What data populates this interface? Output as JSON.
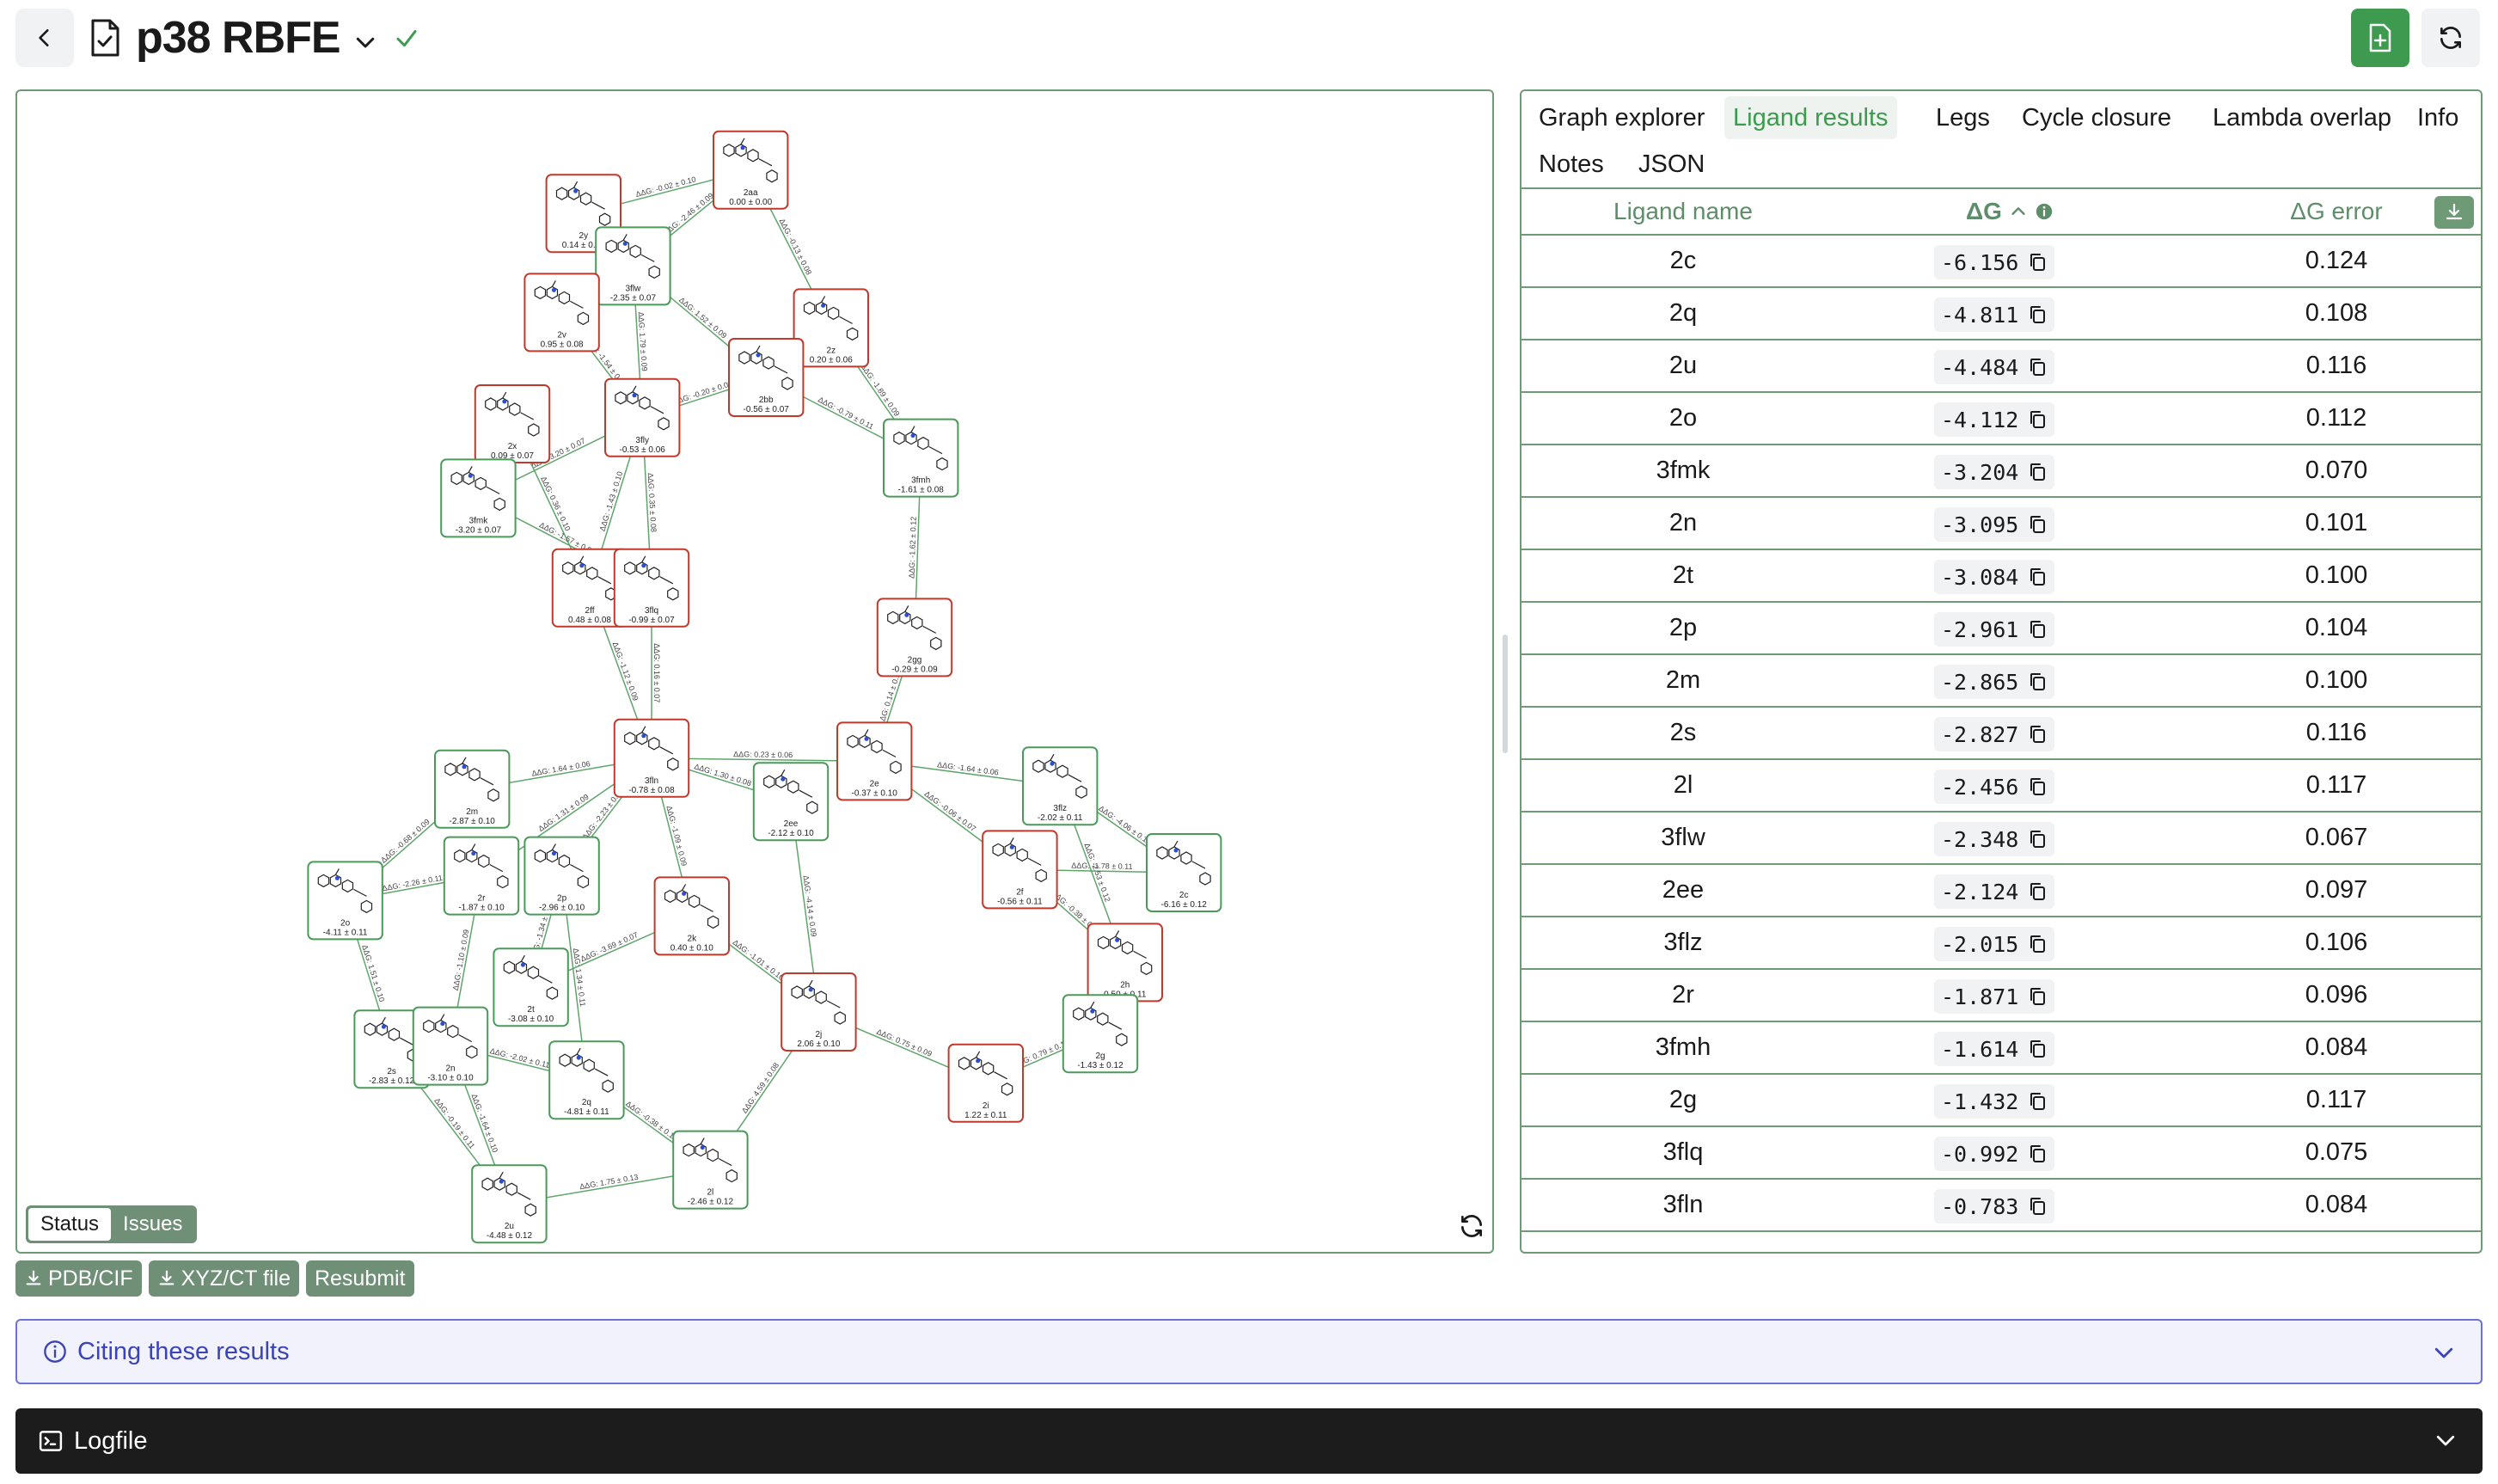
{
  "header": {
    "title": "p38 RBFE",
    "icons": {
      "back": "chevron-left-icon",
      "doc": "document-check-icon",
      "chevron": "chevron-down-icon",
      "check": "check-icon",
      "new_file": "file-plus-icon",
      "refresh": "refresh-icon"
    }
  },
  "graph": {
    "nodes": [
      {
        "id": "2aa",
        "value": "0.00 ± 0.00",
        "status": "red"
      },
      {
        "id": "2y",
        "value": "0.14 ± 0.09",
        "status": "red"
      },
      {
        "id": "3flw",
        "value": "-2.35 ± 0.07",
        "status": "green"
      },
      {
        "id": "2v",
        "value": "0.95 ± 0.08",
        "status": "red"
      },
      {
        "id": "2z",
        "value": "0.20 ± 0.06",
        "status": "red"
      },
      {
        "id": "2bb",
        "value": "-0.56 ± 0.07",
        "status": "red"
      },
      {
        "id": "3fly",
        "value": "-0.53 ± 0.06",
        "status": "red"
      },
      {
        "id": "2x",
        "value": "0.09 ± 0.07",
        "status": "red"
      },
      {
        "id": "3fmk",
        "value": "-3.20 ± 0.07",
        "status": "green"
      },
      {
        "id": "3fmh",
        "value": "-1.61 ± 0.08",
        "status": "green"
      },
      {
        "id": "2ff",
        "value": "0.48 ± 0.08",
        "status": "red"
      },
      {
        "id": "3flq",
        "value": "-0.99 ± 0.07",
        "status": "red"
      },
      {
        "id": "2gg",
        "value": "-0.29 ± 0.09",
        "status": "red"
      },
      {
        "id": "3fln",
        "value": "-0.78 ± 0.08",
        "status": "red"
      },
      {
        "id": "2e",
        "value": "-0.37 ± 0.10",
        "status": "red"
      },
      {
        "id": "2m",
        "value": "-2.87 ± 0.10",
        "status": "green"
      },
      {
        "id": "2ee",
        "value": "-2.12 ± 0.10",
        "status": "green"
      },
      {
        "id": "3flz",
        "value": "-2.02 ± 0.11",
        "status": "green"
      },
      {
        "id": "2c",
        "value": "-6.16 ± 0.12",
        "status": "green"
      },
      {
        "id": "2o",
        "value": "-4.11 ± 0.11",
        "status": "green"
      },
      {
        "id": "2r",
        "value": "-1.87 ± 0.10",
        "status": "green"
      },
      {
        "id": "2p",
        "value": "-2.96 ± 0.10",
        "status": "green"
      },
      {
        "id": "2f",
        "value": "-0.56 ± 0.11",
        "status": "red"
      },
      {
        "id": "2k",
        "value": "0.40 ± 0.10",
        "status": "red"
      },
      {
        "id": "2t",
        "value": "-3.08 ± 0.10",
        "status": "green"
      },
      {
        "id": "2h",
        "value": "0.50 ± 0.11",
        "status": "red"
      },
      {
        "id": "2j",
        "value": "2.06 ± 0.10",
        "status": "red"
      },
      {
        "id": "2g",
        "value": "-1.43 ± 0.12",
        "status": "green"
      },
      {
        "id": "2s",
        "value": "-2.83 ± 0.12",
        "status": "green"
      },
      {
        "id": "2n",
        "value": "-3.10 ± 0.10",
        "status": "green"
      },
      {
        "id": "2q",
        "value": "-4.81 ± 0.11",
        "status": "green"
      },
      {
        "id": "2i",
        "value": "1.22 ± 0.11",
        "status": "red"
      },
      {
        "id": "2u",
        "value": "-4.48 ± 0.12",
        "status": "green"
      },
      {
        "id": "2l",
        "value": "-2.46 ± 0.12",
        "status": "green"
      }
    ],
    "edges": [
      {
        "from": "2y",
        "to": "2aa",
        "label": "ΔΔG: -0.02 ± 0.10"
      },
      {
        "from": "3flw",
        "to": "2aa",
        "label": "ΔΔG: -2.46 ± 0.09"
      },
      {
        "from": "2aa",
        "to": "2z",
        "label": "ΔΔG: -0.13 ± 0.08"
      },
      {
        "from": "3flw",
        "to": "2bb",
        "label": "ΔΔG: 1.52 ± 0.09"
      },
      {
        "from": "2v",
        "to": "3fly",
        "label": "ΔΔG: -1.54 ± 0.10"
      },
      {
        "from": "3flw",
        "to": "3fly",
        "label": "ΔΔG: 1.79 ± 0.09"
      },
      {
        "from": "3fly",
        "to": "2bb",
        "label": "ΔΔG: -0.20 ± 0.09"
      },
      {
        "from": "2bb",
        "to": "2z",
        "label": "ΔΔG: 0.77 ± 0.07"
      },
      {
        "from": "2bb",
        "to": "3fmh",
        "label": "ΔΔG: -0.79 ± 0.11"
      },
      {
        "from": "2z",
        "to": "3fmh",
        "label": "ΔΔG: -1.89 ± 0.09"
      },
      {
        "from": "3fmk",
        "to": "3fly",
        "label": "ΔΔG: 3.20 ± 0.07"
      },
      {
        "from": "2x",
        "to": "2ff",
        "label": "ΔΔG: 0.36 ± 0.10"
      },
      {
        "from": "3fmk",
        "to": "3flq",
        "label": "ΔΔG: -1.57 ± 0.07"
      },
      {
        "from": "3fly",
        "to": "2ff",
        "label": "ΔΔG: -1.43 ± 0.10"
      },
      {
        "from": "3fly",
        "to": "3flq",
        "label": "ΔΔG: 0.35 ± 0.08"
      },
      {
        "from": "3fmh",
        "to": "2gg",
        "label": "ΔΔG: -1.62 ± 0.12"
      },
      {
        "from": "2ff",
        "to": "3fln",
        "label": "ΔΔG: -1.12 ± 0.09"
      },
      {
        "from": "3flq",
        "to": "3fln",
        "label": "ΔΔG: 0.16 ± 0.07"
      },
      {
        "from": "2gg",
        "to": "2e",
        "label": "ΔΔG: 0.14 ± 0.11"
      },
      {
        "from": "2m",
        "to": "3fln",
        "label": "ΔΔG: 1.64 ± 0.06"
      },
      {
        "from": "3fln",
        "to": "2e",
        "label": "ΔΔG: 0.23 ± 0.06"
      },
      {
        "from": "3fln",
        "to": "2ee",
        "label": "ΔΔG: 1.30 ± 0.08"
      },
      {
        "from": "2e",
        "to": "3flz",
        "label": "ΔΔG: -1.64 ± 0.06"
      },
      {
        "from": "2e",
        "to": "2f",
        "label": "ΔΔG: -0.06 ± 0.07"
      },
      {
        "from": "3flz",
        "to": "2c",
        "label": "ΔΔG: -4.06 ± 0.12"
      },
      {
        "from": "2f",
        "to": "2c",
        "label": "ΔΔG: -1.78 ± 0.11"
      },
      {
        "from": "2o",
        "to": "2m",
        "label": "ΔΔG: -0.68 ± 0.09"
      },
      {
        "from": "2r",
        "to": "3fln",
        "label": "ΔΔG: 1.31 ± 0.09"
      },
      {
        "from": "2p",
        "to": "3fln",
        "label": "ΔΔG: -2.23 ± 0.09"
      },
      {
        "from": "3fln",
        "to": "2k",
        "label": "ΔΔG: -1.09 ± 0.09"
      },
      {
        "from": "2o",
        "to": "2r",
        "label": "ΔΔG: -2.26 ± 0.11"
      },
      {
        "from": "2ee",
        "to": "2j",
        "label": "ΔΔG: -4.14 ± 0.09"
      },
      {
        "from": "3flz",
        "to": "2h",
        "label": "ΔΔG: -2.53 ± 0.12"
      },
      {
        "from": "2f",
        "to": "2h",
        "label": "ΔΔG: -0.38 ± 0.11"
      },
      {
        "from": "2o",
        "to": "2s",
        "label": "ΔΔG: 1.51 ± 0.10"
      },
      {
        "from": "2r",
        "to": "2n",
        "label": "ΔΔG: -1.10 ± 0.09"
      },
      {
        "from": "2p",
        "to": "2t",
        "label": "ΔΔG: -1.34 ± 0.10"
      },
      {
        "from": "2t",
        "to": "2k",
        "label": "ΔΔG: -3.69 ± 0.07"
      },
      {
        "from": "2p",
        "to": "2q",
        "label": "ΔΔG: 1.34 ± 0.11"
      },
      {
        "from": "2k",
        "to": "2j",
        "label": "ΔΔG: -1.01 ± 0.10"
      },
      {
        "from": "2j",
        "to": "2i",
        "label": "ΔΔG: 0.75 ± 0.09"
      },
      {
        "from": "2h",
        "to": "2g",
        "label": "ΔΔG: -0.46 ± 0.08"
      },
      {
        "from": "2i",
        "to": "2g",
        "label": "ΔΔG: 0.79 ± 0.11"
      },
      {
        "from": "2s",
        "to": "2n",
        "label": "ΔΔG: 1.45 ± 0.12"
      },
      {
        "from": "2n",
        "to": "2q",
        "label": "ΔΔG: -2.02 ± 0.11"
      },
      {
        "from": "2s",
        "to": "2u",
        "label": "ΔΔG: -0.19 ± 0.11"
      },
      {
        "from": "2n",
        "to": "2u",
        "label": "ΔΔG: -1.64 ± 0.10"
      },
      {
        "from": "2q",
        "to": "2l",
        "label": "ΔΔG: -0.38 ± 0.11"
      },
      {
        "from": "2j",
        "to": "2l",
        "label": "ΔΔG: 4.59 ± 0.08"
      },
      {
        "from": "2u",
        "to": "2l",
        "label": "ΔΔG: 1.75 ± 0.13"
      }
    ],
    "status_toggle": {
      "status": "Status",
      "issues": "Issues"
    }
  },
  "results": {
    "tabs": [
      "Graph explorer",
      "Ligand results",
      "Legs",
      "Cycle closure",
      "Lambda overlap",
      "Info",
      "Notes",
      "JSON"
    ],
    "active_tab": "Ligand results",
    "columns": {
      "name": "Ligand name",
      "dg": "ΔG",
      "err": "ΔG error"
    },
    "sort": "ascending",
    "rows": [
      {
        "name": "2c",
        "dg": "-6.156",
        "err": "0.124"
      },
      {
        "name": "2q",
        "dg": "-4.811",
        "err": "0.108"
      },
      {
        "name": "2u",
        "dg": "-4.484",
        "err": "0.116"
      },
      {
        "name": "2o",
        "dg": "-4.112",
        "err": "0.112"
      },
      {
        "name": "3fmk",
        "dg": "-3.204",
        "err": "0.070"
      },
      {
        "name": "2n",
        "dg": "-3.095",
        "err": "0.101"
      },
      {
        "name": "2t",
        "dg": "-3.084",
        "err": "0.100"
      },
      {
        "name": "2p",
        "dg": "-2.961",
        "err": "0.104"
      },
      {
        "name": "2m",
        "dg": "-2.865",
        "err": "0.100"
      },
      {
        "name": "2s",
        "dg": "-2.827",
        "err": "0.116"
      },
      {
        "name": "2l",
        "dg": "-2.456",
        "err": "0.117"
      },
      {
        "name": "3flw",
        "dg": "-2.348",
        "err": "0.067"
      },
      {
        "name": "2ee",
        "dg": "-2.124",
        "err": "0.097"
      },
      {
        "name": "3flz",
        "dg": "-2.015",
        "err": "0.106"
      },
      {
        "name": "2r",
        "dg": "-1.871",
        "err": "0.096"
      },
      {
        "name": "3fmh",
        "dg": "-1.614",
        "err": "0.084"
      },
      {
        "name": "2g",
        "dg": "-1.432",
        "err": "0.117"
      },
      {
        "name": "3flq",
        "dg": "-0.992",
        "err": "0.075"
      },
      {
        "name": "3fln",
        "dg": "-0.783",
        "err": "0.084"
      }
    ]
  },
  "buttons": {
    "pdb": "PDB/CIF",
    "xyz": "XYZ/CT file",
    "resubmit": "Resubmit"
  },
  "citing": {
    "label": "Citing these results"
  },
  "logfile": {
    "label": "Logfile"
  },
  "colors": {
    "accent": "#3d9a4f",
    "border": "#6f9a76",
    "node_red": "#c0392b",
    "node_green": "#4a9a5a",
    "citing": "#3b43b8"
  }
}
